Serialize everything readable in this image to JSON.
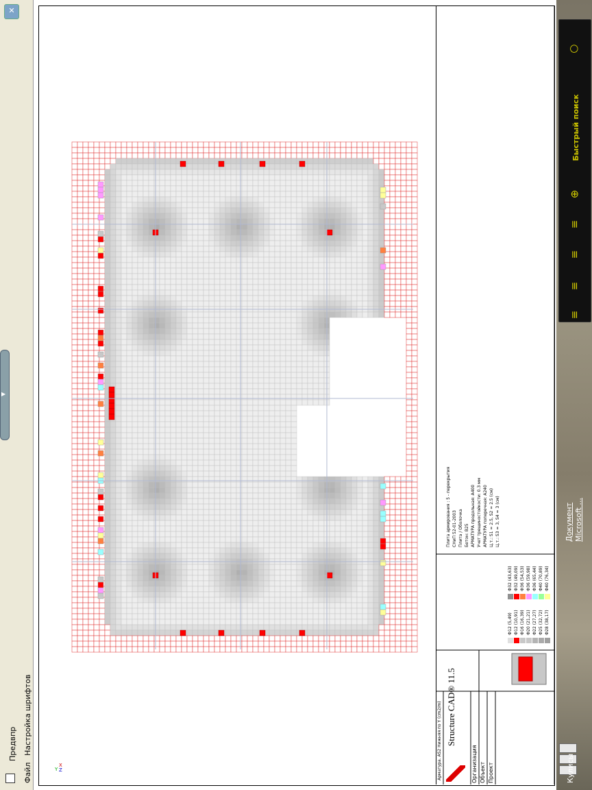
{
  "window": {
    "close_glyph": "✕",
    "menu": [
      "Файл",
      "Настройка шрифтов"
    ],
    "preview_label": "Предвпр"
  },
  "sidebar": {
    "quick_search_label": "Быстрый поиск",
    "icons": [
      "search-icon",
      "zoom-in-icon",
      "list-icon",
      "list-icon",
      "list-icon",
      "list-icon"
    ]
  },
  "taskbar": {
    "item_line1": "Документ",
    "item_line2": "Microsoft ...",
    "bottom_item": "Кулисы"
  },
  "drawing": {
    "title_row": "Арматура. AS2 Нижняя по Y (cm2/m)",
    "app_name": "Structure CAD® 11.5",
    "org_labels": [
      "Организация",
      "Объект",
      "Проект"
    ],
    "axis_labels": [
      "X",
      "Y",
      "Z"
    ],
    "legend": [
      {
        "label": "Ф12 (5,49)",
        "color": "#e0e0e0"
      },
      {
        "label": "Ф12 (10,91)",
        "color": "#ff0000"
      },
      {
        "label": "Ф16 (16,39)",
        "color": "#c8c8c8"
      },
      {
        "label": "Ф20 (21,21)",
        "color": "#c8c8c8"
      },
      {
        "label": "Ф22 (27,27)",
        "color": "#b4b4b4"
      },
      {
        "label": "Ф25 (32,72)",
        "color": "#aaaaaa"
      },
      {
        "label": "Ф28 (38,17)",
        "color": "#a0a0a0"
      },
      {
        "label": "Ф32 (43,63)",
        "color": "#909090"
      },
      {
        "label": "Ф32 (49,09)",
        "color": "#ff0000"
      },
      {
        "label": "Ф36 (54,53)",
        "color": "#ff8040"
      },
      {
        "label": "Ф36 (59,98)",
        "color": "#ff99ff"
      },
      {
        "label": "Ф36 (65,44)",
        "color": "#99ffff"
      },
      {
        "label": "Ф40 (70,89)",
        "color": "#99ff99"
      },
      {
        "label": "Ф40 (76,34)",
        "color": "#ffff99"
      }
    ],
    "notes": [
      "Плита армирования : 5 - перекрытия",
      "СНиП 52-01-2003",
      "Плита / Оболочка",
      "Бетон: B25",
      "АРМАТУРА продольная: A400",
      "Учет трещиностойкости: 0.3 мм",
      "АРМАТУРА поперечная: A240",
      "Ц.т.: S1 = 2.5, S2 = 2.5 (см)",
      "Ц.т.: S3 = 3, S4 = 3 (см)"
    ]
  }
}
